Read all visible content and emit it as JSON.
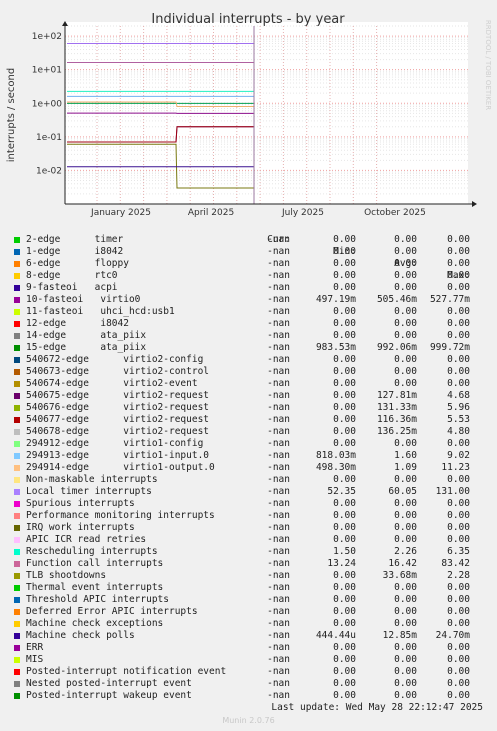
{
  "chart_data": {
    "type": "line",
    "title": "Individual interrupts - by year",
    "ylabel": "interrupts / second",
    "yscale": "log",
    "ylim": [
      0.001,
      200
    ],
    "ytick_labels": [
      "1e+02",
      "1e+01",
      "1e+00",
      "1e-01",
      "1e-02"
    ],
    "ytick_values": [
      100,
      10,
      1,
      0.1,
      0.01
    ],
    "xtick_labels": [
      "January 2025",
      "April 2025",
      "July 2025",
      "October 2025"
    ],
    "grid": true,
    "watermark": "RRDTOOL / TOBI OETIKER",
    "series": [
      {
        "name": "10-fasteoi virtio0",
        "color": "#8c0f8c",
        "values": [
          0.51,
          0.51,
          0.5
        ]
      },
      {
        "name": "15-edge ata_piix",
        "color": "#00a050",
        "values": [
          0.99,
          0.99,
          0.99
        ]
      },
      {
        "name": "294913-edge virtio1-input.0",
        "color": "#70b0f0",
        "values": [
          1.6,
          1.6,
          1.6
        ]
      },
      {
        "name": "294914-edge virtio1-output.0",
        "color": "#f0b070",
        "values": [
          1.09,
          1.09,
          0.8
        ]
      },
      {
        "name": "Local timer interrupts",
        "color": "#a070f0",
        "values": [
          60.05,
          60.05,
          60.05
        ]
      },
      {
        "name": "Rescheduling interrupts",
        "color": "#20f0c0",
        "values": [
          2.26,
          2.26,
          2.26
        ]
      },
      {
        "name": "Function call interrupts",
        "color": "#b060a0",
        "values": [
          16.42,
          16.42,
          16.42
        ]
      },
      {
        "name": "TLB shootdowns",
        "color": "#7a7a10",
        "values": [
          0.06,
          0.06,
          0.003
        ]
      },
      {
        "name": "Machine check polls",
        "color": "#3a1090",
        "values": [
          0.01285,
          0.01285,
          0.01285
        ]
      },
      {
        "name": "540675-edge virtio2-request",
        "color": "#6a0f6a",
        "values": [
          0.07,
          0.07,
          0.2
        ]
      },
      {
        "name": "540677-edge virtio2-request",
        "color": "#a00010",
        "values": [
          0.07,
          0.07,
          0.2
        ]
      }
    ]
  },
  "legend": {
    "header": {
      "cur": "Cur:",
      "min": "Min:",
      "avg": "Avg:",
      "max": "Max:"
    },
    "rows": [
      {
        "name": "2-edge      timer",
        "color": "#00cc00",
        "cur": "-nan",
        "min": "0.00",
        "avg": "0.00",
        "max": "0.00"
      },
      {
        "name": "1-edge      i8042",
        "color": "#0066b3",
        "cur": "-nan",
        "min": "0.00",
        "avg": "0.00",
        "max": "0.00"
      },
      {
        "name": "6-edge      floppy",
        "color": "#ff8000",
        "cur": "-nan",
        "min": "0.00",
        "avg": "0.00",
        "max": "0.00"
      },
      {
        "name": "8-edge      rtc0",
        "color": "#ffcc00",
        "cur": "-nan",
        "min": "0.00",
        "avg": "0.00",
        "max": "0.00"
      },
      {
        "name": "9-fasteoi   acpi",
        "color": "#330099",
        "cur": "-nan",
        "min": "0.00",
        "avg": "0.00",
        "max": "0.00"
      },
      {
        "name": "10-fasteoi   virtio0",
        "color": "#990099",
        "cur": "-nan",
        "min": "497.19m",
        "avg": "505.46m",
        "max": "527.77m"
      },
      {
        "name": "11-fasteoi   uhci_hcd:usb1",
        "color": "#ccff00",
        "cur": "-nan",
        "min": "0.00",
        "avg": "0.00",
        "max": "0.00"
      },
      {
        "name": "12-edge      i8042",
        "color": "#ff0000",
        "cur": "-nan",
        "min": "0.00",
        "avg": "0.00",
        "max": "0.00"
      },
      {
        "name": "14-edge      ata_piix",
        "color": "#808080",
        "cur": "-nan",
        "min": "0.00",
        "avg": "0.00",
        "max": "0.00"
      },
      {
        "name": "15-edge      ata_piix",
        "color": "#008f00",
        "cur": "-nan",
        "min": "983.53m",
        "avg": "992.06m",
        "max": "999.72m"
      },
      {
        "name": "540672-edge      virtio2-config",
        "color": "#00487d",
        "cur": "-nan",
        "min": "0.00",
        "avg": "0.00",
        "max": "0.00"
      },
      {
        "name": "540673-edge      virtio2-control",
        "color": "#b35a00",
        "cur": "-nan",
        "min": "0.00",
        "avg": "0.00",
        "max": "0.00"
      },
      {
        "name": "540674-edge      virtio2-event",
        "color": "#b38f00",
        "cur": "-nan",
        "min": "0.00",
        "avg": "0.00",
        "max": "0.00"
      },
      {
        "name": "540675-edge      virtio2-request",
        "color": "#6b006b",
        "cur": "-nan",
        "min": "0.00",
        "avg": "127.81m",
        "max": "4.68"
      },
      {
        "name": "540676-edge      virtio2-request",
        "color": "#8fb300",
        "cur": "-nan",
        "min": "0.00",
        "avg": "131.33m",
        "max": "5.96"
      },
      {
        "name": "540677-edge      virtio2-request",
        "color": "#b30000",
        "cur": "-nan",
        "min": "0.00",
        "avg": "116.36m",
        "max": "5.53"
      },
      {
        "name": "540678-edge      virtio2-request",
        "color": "#bebebe",
        "cur": "-nan",
        "min": "0.00",
        "avg": "136.25m",
        "max": "4.80"
      },
      {
        "name": "294912-edge      virtio1-config",
        "color": "#80ff80",
        "cur": "-nan",
        "min": "0.00",
        "avg": "0.00",
        "max": "0.00"
      },
      {
        "name": "294913-edge      virtio1-input.0",
        "color": "#80c9ff",
        "cur": "-nan",
        "min": "818.03m",
        "avg": "1.60",
        "max": "9.02"
      },
      {
        "name": "294914-edge      virtio1-output.0",
        "color": "#ffc080",
        "cur": "-nan",
        "min": "498.30m",
        "avg": "1.09",
        "max": "11.23"
      },
      {
        "name": "Non-maskable interrupts",
        "color": "#ffe680",
        "cur": "-nan",
        "min": "0.00",
        "avg": "0.00",
        "max": "0.00"
      },
      {
        "name": "Local timer interrupts",
        "color": "#aa80ff",
        "cur": "-nan",
        "min": "52.35",
        "avg": "60.05",
        "max": "131.00"
      },
      {
        "name": "Spurious interrupts",
        "color": "#ee00cc",
        "cur": "-nan",
        "min": "0.00",
        "avg": "0.00",
        "max": "0.00"
      },
      {
        "name": "Performance monitoring interrupts",
        "color": "#ff8080",
        "cur": "-nan",
        "min": "0.00",
        "avg": "0.00",
        "max": "0.00"
      },
      {
        "name": "IRQ work interrupts",
        "color": "#666600",
        "cur": "-nan",
        "min": "0.00",
        "avg": "0.00",
        "max": "0.00"
      },
      {
        "name": "APIC ICR read retries",
        "color": "#ffbfff",
        "cur": "-nan",
        "min": "0.00",
        "avg": "0.00",
        "max": "0.00"
      },
      {
        "name": "Rescheduling interrupts",
        "color": "#00ffcc",
        "cur": "-nan",
        "min": "1.50",
        "avg": "2.26",
        "max": "6.35"
      },
      {
        "name": "Function call interrupts",
        "color": "#cc6699",
        "cur": "-nan",
        "min": "13.24",
        "avg": "16.42",
        "max": "83.42"
      },
      {
        "name": "TLB shootdowns",
        "color": "#999900",
        "cur": "-nan",
        "min": "0.00",
        "avg": "33.68m",
        "max": "2.28"
      },
      {
        "name": "Thermal event interrupts",
        "color": "#00cc00",
        "cur": "-nan",
        "min": "0.00",
        "avg": "0.00",
        "max": "0.00"
      },
      {
        "name": "Threshold APIC interrupts",
        "color": "#0066b3",
        "cur": "-nan",
        "min": "0.00",
        "avg": "0.00",
        "max": "0.00"
      },
      {
        "name": "Deferred Error APIC interrupts",
        "color": "#ff8000",
        "cur": "-nan",
        "min": "0.00",
        "avg": "0.00",
        "max": "0.00"
      },
      {
        "name": "Machine check exceptions",
        "color": "#ffcc00",
        "cur": "-nan",
        "min": "0.00",
        "avg": "0.00",
        "max": "0.00"
      },
      {
        "name": "Machine check polls",
        "color": "#330099",
        "cur": "-nan",
        "min": "444.44u",
        "avg": "12.85m",
        "max": "24.70m"
      },
      {
        "name": "ERR",
        "color": "#990099",
        "cur": "-nan",
        "min": "0.00",
        "avg": "0.00",
        "max": "0.00"
      },
      {
        "name": "MIS",
        "color": "#ccff00",
        "cur": "-nan",
        "min": "0.00",
        "avg": "0.00",
        "max": "0.00"
      },
      {
        "name": "Posted-interrupt notification event",
        "color": "#ff0000",
        "cur": "-nan",
        "min": "0.00",
        "avg": "0.00",
        "max": "0.00"
      },
      {
        "name": "Nested posted-interrupt event",
        "color": "#808080",
        "cur": "-nan",
        "min": "0.00",
        "avg": "0.00",
        "max": "0.00"
      },
      {
        "name": "Posted-interrupt wakeup event",
        "color": "#008f00",
        "cur": "-nan",
        "min": "0.00",
        "avg": "0.00",
        "max": "0.00"
      }
    ]
  },
  "last_update": "Last update: Wed May 28 22:12:47 2025",
  "footer": "Munin 2.0.76"
}
